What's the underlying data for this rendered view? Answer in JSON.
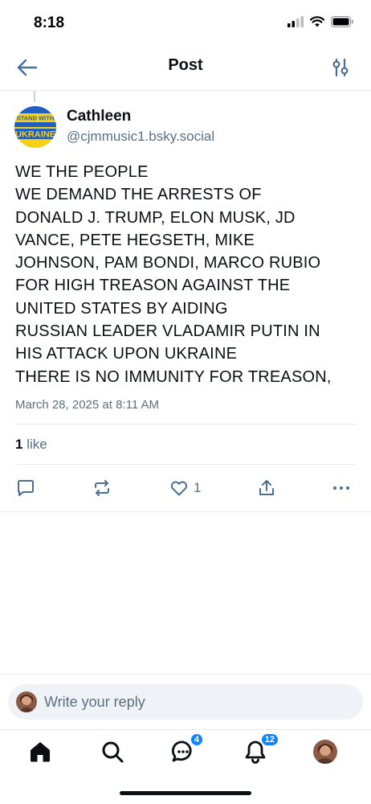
{
  "status_bar": {
    "time": "8:18"
  },
  "header": {
    "title": "Post",
    "back_icon": "arrow-left-icon",
    "filter_icon": "sliders-icon"
  },
  "post": {
    "author_name": "Cathleen",
    "author_handle": "@cjmmusic1.bsky.social",
    "avatar_text_top": "STAND WITH",
    "avatar_text_bottom": "UKRAINE",
    "lines": [
      "WE THE PEOPLE",
      "WE DEMAND THE ARRESTS OF",
      "DONALD J. TRUMP, ELON MUSK, JD",
      "VANCE, PETE HEGSETH, MIKE",
      "JOHNSON, PAM BONDI, MARCO RUBIO",
      "FOR HIGH TREASON AGAINST THE",
      "UNITED STATES BY AIDING",
      "RUSSIAN LEADER VLADAMIR PUTIN IN",
      "HIS ATTACK UPON UKRAINE",
      "THERE IS NO IMMUNITY FOR TREASON,"
    ],
    "date": "March 28, 2025 at 8:11 AM",
    "likes_count": "1",
    "likes_label": "like",
    "like_action_count": "1"
  },
  "reply": {
    "placeholder": "Write your reply"
  },
  "nav": {
    "messages_badge": "4",
    "notifications_badge": "12"
  },
  "colors": {
    "accent": "#1083fe",
    "icon": "#4a6e94",
    "secondary_text": "#5b6f82",
    "ukraine_blue": "#1f5fbf",
    "ukraine_yellow": "#f7d117"
  }
}
